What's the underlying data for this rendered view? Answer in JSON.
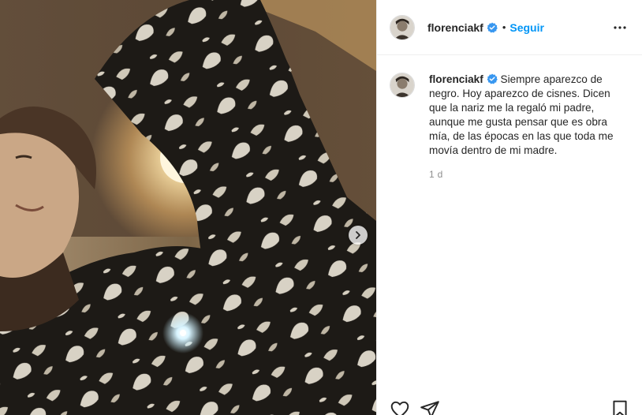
{
  "post": {
    "username": "florenciakf",
    "verified": true,
    "follow_label": "Seguir",
    "separator": "•",
    "caption": "Siempre aparezco de negro. Hoy aparezco de cisnes. Dicen que la nariz me la regaló mi padre, aunque me gusta pensar que es obra mía, de las épocas en las que toda me movía dentro de mi madre.",
    "timestamp": "1 d"
  },
  "icons": {
    "verified": "verified-badge-icon",
    "more": "more-options-icon",
    "next": "chevron-right-icon",
    "like": "heart-icon",
    "share": "paper-plane-icon",
    "save": "bookmark-icon"
  },
  "colors": {
    "link_blue": "#0095f6",
    "verified_blue": "#3897f0",
    "text": "#262626",
    "muted": "#8e8e8e"
  }
}
